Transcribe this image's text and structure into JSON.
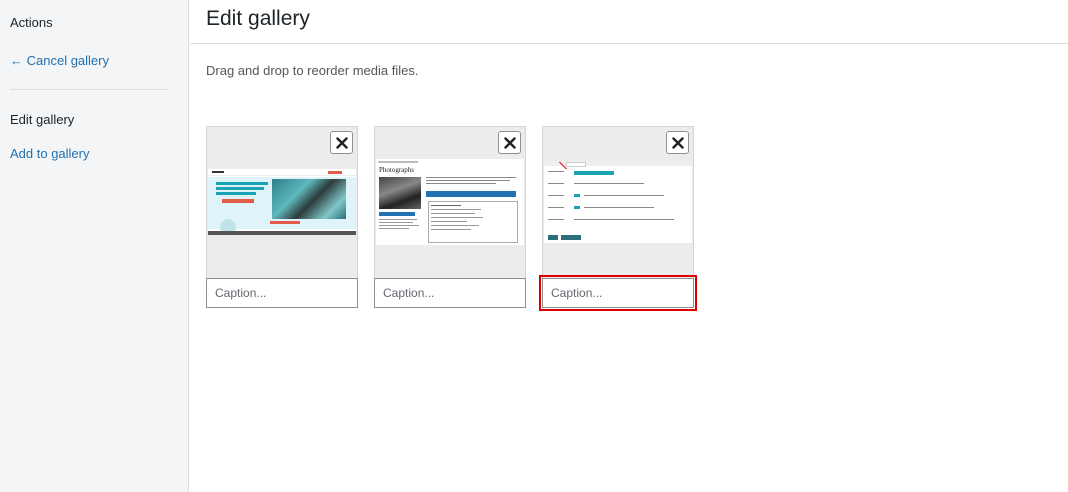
{
  "sidebar": {
    "actions_heading": "Actions",
    "cancel_link": "← Cancel gallery",
    "edit_heading": "Edit gallery",
    "add_link": "Add to gallery"
  },
  "main": {
    "title": "Edit gallery",
    "instructions": "Drag and drop to reorder media files."
  },
  "items": [
    {
      "caption_placeholder": "Caption...",
      "caption_value": "",
      "selected": false
    },
    {
      "caption_placeholder": "Caption...",
      "caption_value": "",
      "selected": false,
      "thumb_heading": "Photographs"
    },
    {
      "caption_placeholder": "Caption...",
      "caption_value": "",
      "selected": true
    }
  ],
  "colors": {
    "link": "#2271b1",
    "sidebar_bg": "#f3f5f6",
    "selection_outline": "#e00000",
    "accent_teal": "#1aa3b5"
  },
  "icons": {
    "remove": "close-x-icon"
  }
}
